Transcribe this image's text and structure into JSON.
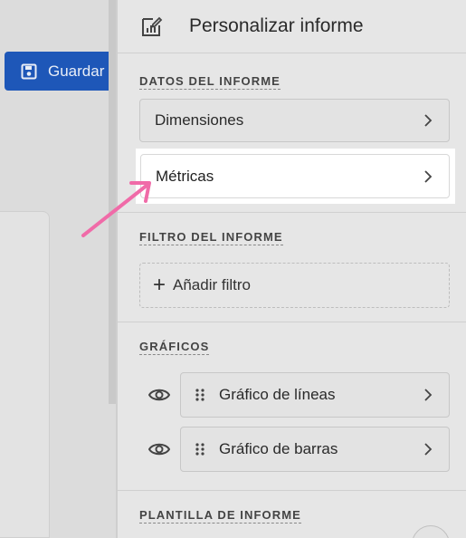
{
  "toolbar": {
    "save_label": "Guardar"
  },
  "panel": {
    "title": "Personalizar informe",
    "sections": {
      "report_data": {
        "title": "DATOS DEL INFORME",
        "dimensions_label": "Dimensiones",
        "metrics_label": "Métricas"
      },
      "report_filter": {
        "title": "FILTRO DEL INFORME",
        "add_filter_label": "Añadir filtro"
      },
      "charts": {
        "title": "GRÁFICOS",
        "items": [
          {
            "label": "Gráfico de líneas"
          },
          {
            "label": "Gráfico de barras"
          }
        ]
      },
      "report_template": {
        "title": "PLANTILLA DE INFORME"
      }
    }
  },
  "annotation": {
    "arrow_color": "#f06ba8",
    "highlight": "Métricas"
  },
  "colors": {
    "save_button": "#1e57b8",
    "panel_bg": "#e6e6e6"
  },
  "icons": [
    "save-icon",
    "edit-report-icon",
    "chevron-right-icon",
    "plus-icon",
    "eye-icon",
    "drag-handle-icon"
  ]
}
